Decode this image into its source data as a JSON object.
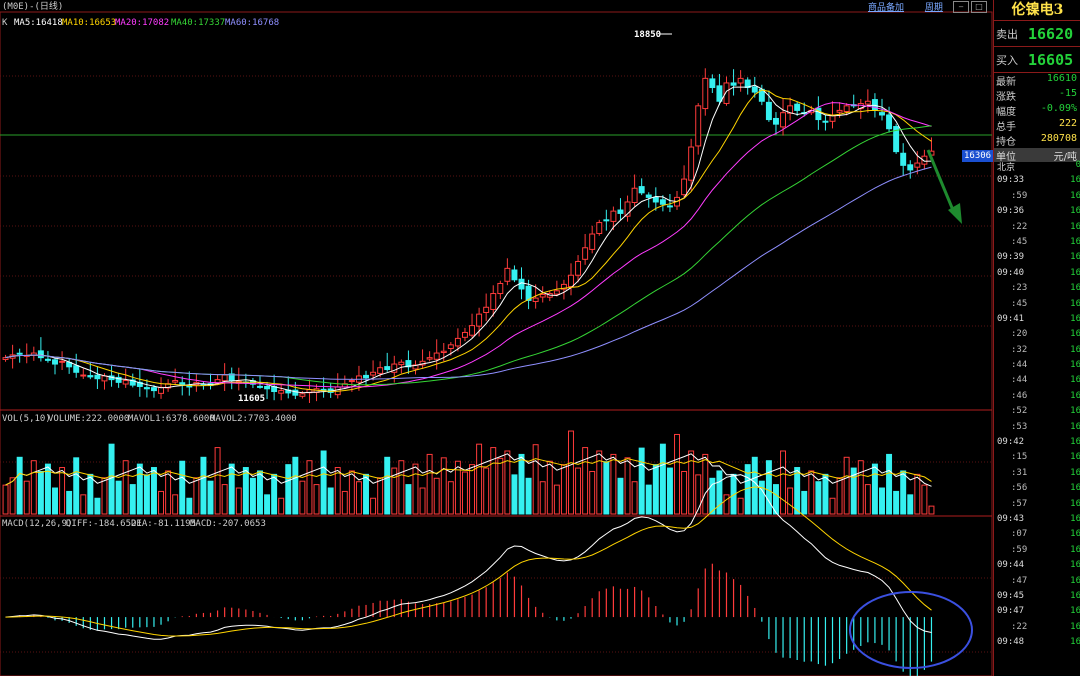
{
  "header": {
    "code_title": "(M0E)-(日线)",
    "links": [
      "商品备加",
      "周期"
    ]
  },
  "main_legend": {
    "k_label": "K",
    "ma": [
      {
        "label": "MA5:16418",
        "color": "#ffffff"
      },
      {
        "label": "MA10:16653",
        "color": "#ffd400"
      },
      {
        "label": "MA20:17082",
        "color": "#ff3cff"
      },
      {
        "label": "MA40:17337",
        "color": "#35d435"
      },
      {
        "label": "MA60:16768",
        "color": "#8f8fff"
      }
    ]
  },
  "vol_legend": {
    "label": "VOL(5,10)",
    "volume": "VOLUME:222.0000",
    "mavol1": "MAVOL1:6378.6000",
    "mavol2": "MAVOL2:7703.4000"
  },
  "macd_legend": {
    "label": "MACD(12,26,9)",
    "diff": "DIFF:-184.6521",
    "dea": "DEA:-81.1195",
    "macd": "MACD:-207.0653"
  },
  "annotations": {
    "high": "18850",
    "low": "11605",
    "current_price_tag": "16306"
  },
  "colors": {
    "up": "#ff3b3b",
    "down": "#35f0f0",
    "quote_green": "#23d23a",
    "macd_circle": "#3b50e0",
    "arrow": "#1e8a2e"
  },
  "right_panel": {
    "title": "伦镍电3",
    "sell": {
      "label": "卖出",
      "value": "16620"
    },
    "buy": {
      "label": "买入",
      "value": "16605"
    },
    "rows": [
      {
        "k": "最新",
        "v": "16610",
        "color": "#23d23a"
      },
      {
        "k": "涨跌",
        "v": "-15",
        "color": "#23d23a"
      },
      {
        "k": "幅度",
        "v": "-0.09%",
        "color": "#23d23a"
      },
      {
        "k": "总手",
        "v": "222",
        "color": "#ffe24a"
      },
      {
        "k": "持仓",
        "v": "280708",
        "color": "#ffe24a"
      }
    ],
    "unit": {
      "k": "单位",
      "v": "元/吨"
    },
    "ticks": [
      {
        "t": "北京",
        "p": "0",
        "minor": false
      },
      {
        "t": "09:33",
        "p": "16",
        "minor": false
      },
      {
        "t": ":59",
        "p": "16",
        "minor": true
      },
      {
        "t": "09:36",
        "p": "16",
        "minor": false
      },
      {
        "t": ":22",
        "p": "16",
        "minor": true
      },
      {
        "t": ":45",
        "p": "16",
        "minor": true
      },
      {
        "t": "09:39",
        "p": "16",
        "minor": false
      },
      {
        "t": "09:40",
        "p": "16",
        "minor": false
      },
      {
        "t": ":23",
        "p": "16",
        "minor": true
      },
      {
        "t": ":45",
        "p": "16",
        "minor": true
      },
      {
        "t": "09:41",
        "p": "16",
        "minor": false
      },
      {
        "t": ":20",
        "p": "16",
        "minor": true
      },
      {
        "t": ":32",
        "p": "16",
        "minor": true
      },
      {
        "t": ":44",
        "p": "16",
        "minor": true
      },
      {
        "t": ":44",
        "p": "16",
        "minor": true
      },
      {
        "t": ":46",
        "p": "16",
        "minor": true
      },
      {
        "t": ":52",
        "p": "16",
        "minor": true
      },
      {
        "t": ":53",
        "p": "16",
        "minor": true
      },
      {
        "t": "09:42",
        "p": "16",
        "minor": false
      },
      {
        "t": ":15",
        "p": "16",
        "minor": true
      },
      {
        "t": ":31",
        "p": "16",
        "minor": true
      },
      {
        "t": ":56",
        "p": "16",
        "minor": true
      },
      {
        "t": ":57",
        "p": "16",
        "minor": true
      },
      {
        "t": "09:43",
        "p": "16",
        "minor": false
      },
      {
        "t": ":07",
        "p": "16",
        "minor": true
      },
      {
        "t": ":59",
        "p": "16",
        "minor": true
      },
      {
        "t": "09:44",
        "p": "16",
        "minor": false
      },
      {
        "t": ":47",
        "p": "16",
        "minor": true
      },
      {
        "t": "09:45",
        "p": "16",
        "minor": false
      },
      {
        "t": "09:47",
        "p": "16",
        "minor": false
      },
      {
        "t": ":22",
        "p": "16",
        "minor": true
      },
      {
        "t": "09:48",
        "p": "16",
        "minor": false
      }
    ]
  },
  "chart_data": {
    "type": "candlestick",
    "price_range": [
      11000,
      19300
    ],
    "current_price": 16306,
    "high_marker": 18850,
    "low_marker": 11605,
    "closes": [
      12100,
      12160,
      12180,
      12150,
      12200,
      12100,
      12040,
      11960,
      12020,
      11900,
      11780,
      11720,
      11680,
      11640,
      11700,
      11620,
      11560,
      11600,
      11500,
      11470,
      11420,
      11380,
      11450,
      11530,
      11600,
      11500,
      11460,
      11560,
      11520,
      11490,
      11620,
      11720,
      11600,
      11580,
      11560,
      11520,
      11470,
      11420,
      11360,
      11380,
      11330,
      11280,
      11310,
      11400,
      11420,
      11380,
      11340,
      11460,
      11530,
      11600,
      11700,
      11660,
      11780,
      11880,
      11840,
      11960,
      12000,
      11900,
      11940,
      12020,
      12100,
      12200,
      12240,
      12380,
      12520,
      12650,
      12800,
      13050,
      13200,
      13500,
      13720,
      14050,
      13800,
      13600,
      13350,
      13400,
      13480,
      13500,
      13560,
      13700,
      13900,
      14200,
      14500,
      14800,
      15050,
      15100,
      15300,
      15250,
      15500,
      15800,
      15700,
      15600,
      15500,
      15450,
      15400,
      15600,
      16000,
      16700,
      17600,
      18200,
      18000,
      17700,
      18100,
      18050,
      18200,
      18000,
      17900,
      17700,
      17300,
      17200,
      17450,
      17600,
      17500,
      17450,
      17500,
      17300,
      17250,
      17400,
      17500,
      17600,
      17600,
      17650,
      17700,
      17500,
      17400,
      17100,
      16600,
      16300,
      16200,
      16350,
      16500,
      16610
    ],
    "volume_range": [
      0,
      16000
    ],
    "macd_range": [
      -450,
      650
    ]
  }
}
